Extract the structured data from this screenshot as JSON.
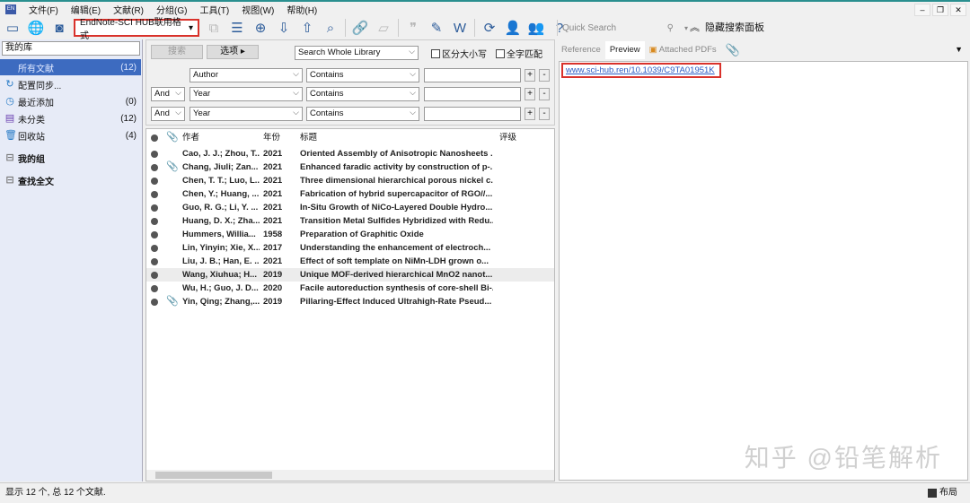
{
  "menu": {
    "items": [
      "文件(F)",
      "编辑(E)",
      "文献(R)",
      "分组(G)",
      "工具(T)",
      "视图(W)",
      "帮助(H)"
    ]
  },
  "toolbar": {
    "style": "EndNote-SCI HUB联用格式",
    "quick_search_placeholder": "Quick Search",
    "hide_panel": "隐藏搜索面板"
  },
  "sidebar": {
    "library_label": "我的库",
    "items": [
      {
        "label": "所有文献",
        "count": "(12)"
      },
      {
        "label": "配置同步...",
        "count": ""
      },
      {
        "label": "最近添加",
        "count": "(0)"
      },
      {
        "label": "未分类",
        "count": "(12)"
      },
      {
        "label": "回收站",
        "count": "(4)"
      }
    ],
    "groups": [
      "我的组",
      "查找全文"
    ]
  },
  "search": {
    "search_button": "搜索",
    "options_button": "选项",
    "scope": "Search Whole Library",
    "match_case": "区分大小写",
    "match_words": "全字匹配",
    "rows": [
      {
        "bool": "",
        "field": "Author",
        "op": "Contains"
      },
      {
        "bool": "And",
        "field": "Year",
        "op": "Contains"
      },
      {
        "bool": "And",
        "field": "Year",
        "op": "Contains"
      }
    ]
  },
  "list": {
    "headers": {
      "author": "作者",
      "year": "年份",
      "title": "标题",
      "rating": "评级"
    },
    "rows": [
      {
        "author": "Cao, J. J.; Zhou, T...",
        "year": "2021",
        "title": "Oriented Assembly of Anisotropic Nanosheets ...",
        "pdf": false
      },
      {
        "author": "Chang, Jiuli; Zan...",
        "year": "2021",
        "title": "Enhanced faradic activity by construction of p-...",
        "pdf": true
      },
      {
        "author": "Chen, T. T.; Luo, L...",
        "year": "2021",
        "title": "Three dimensional hierarchical porous nickel c...",
        "pdf": false
      },
      {
        "author": "Chen, Y.; Huang, ...",
        "year": "2021",
        "title": "Fabrication of hybrid supercapacitor of RGO//...",
        "pdf": false
      },
      {
        "author": "Guo, R. G.; Li, Y. ...",
        "year": "2021",
        "title": "In-Situ Growth of NiCo-Layered Double Hydro...",
        "pdf": false
      },
      {
        "author": "Huang, D. X.; Zha...",
        "year": "2021",
        "title": "Transition Metal Sulfides Hybridized with Redu...",
        "pdf": false
      },
      {
        "author": "Hummers, Willia...",
        "year": "1958",
        "title": "Preparation of Graphitic Oxide",
        "pdf": false
      },
      {
        "author": "Lin, Yinyin; Xie, X...",
        "year": "2017",
        "title": "Understanding the enhancement of electroch...",
        "pdf": false
      },
      {
        "author": "Liu, J. B.; Han, E. ...",
        "year": "2021",
        "title": "Effect of soft template on NiMn-LDH grown o...",
        "pdf": false
      },
      {
        "author": "Wang, Xiuhua; H...",
        "year": "2019",
        "title": "Unique MOF-derived hierarchical MnO2 nanot...",
        "pdf": false
      },
      {
        "author": "Wu, H.; Guo, J. D...",
        "year": "2020",
        "title": "Facile autoreduction synthesis of core-shell Bi-...",
        "pdf": false
      },
      {
        "author": "Yin, Qing; Zhang,...",
        "year": "2019",
        "title": "Pillaring-Effect Induced Ultrahigh-Rate Pseud...",
        "pdf": true
      }
    ]
  },
  "panel": {
    "tabs": [
      "Reference",
      "Preview",
      "Attached PDFs"
    ],
    "link": "www.sci-hub.ren/10.1039/C9TA01951K"
  },
  "watermark": "知乎 @铅笔解析",
  "status": {
    "text": "显示 12 个, 总 12 个文献.",
    "layout": "布局"
  }
}
